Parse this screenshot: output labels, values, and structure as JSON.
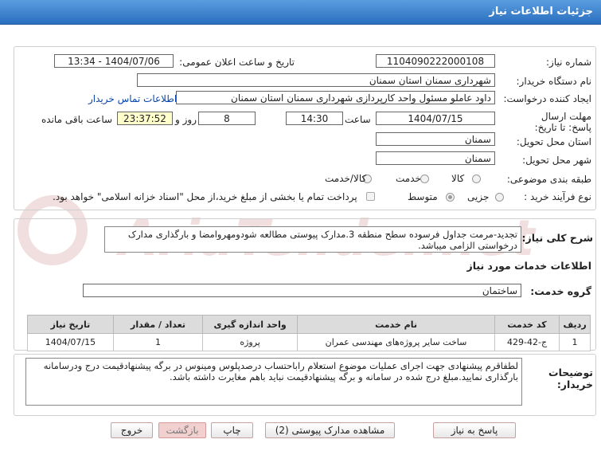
{
  "header": {
    "title": "جزئیات اطلاعات نیاز"
  },
  "form": {
    "need_number_label": "شماره نیاز:",
    "need_number": "1104090222000108",
    "announce_datetime_label": "تاریخ و ساعت اعلان عمومی:",
    "announce_datetime": "1404/07/06 - 13:34",
    "buyer_org_label": "نام دستگاه خریدار:",
    "buyer_org": "شهرداری سمنان استان سمنان",
    "requester_label": "ایجاد کننده درخواست:",
    "requester": "داود عاملو مسئول واحد کارپردازی شهرداری سمنان استان سمنان",
    "contact_link": "اطلاعات تماس خریدار",
    "deadline_label": "مهلت ارسال پاسخ: تا تاریخ:",
    "deadline_date": "1404/07/15",
    "time_label": "ساعت",
    "deadline_time": "14:30",
    "days_value": "8",
    "days_label": "روز و",
    "remaining_time": "23:37:52",
    "remaining_label": "ساعت باقی مانده",
    "province_label": "استان محل تحویل:",
    "province": "سمنان",
    "city_label": "شهر محل تحویل:",
    "city": "سمنان",
    "category_label": "طبقه بندی موضوعی:",
    "category_options": [
      "کالا",
      "خدمت",
      "کالا/خدمت"
    ],
    "process_label": "نوع فرآیند خرید :",
    "process_options": [
      "جزیی",
      "متوسط"
    ],
    "payment_note": "پرداخت تمام یا بخشی از مبلغ خرید،از محل \"اسناد خزانه اسلامی\" خواهد بود."
  },
  "summary": {
    "label": "شرح کلی نیاز:",
    "text": "تجدید-مرمت جداول فرسوده سطح منطقه 3.مدارک پیوستی مطالعه شودومهروامضا و بارگذاری مدارک درخواستی الزامی میباشد."
  },
  "services": {
    "section_title": "اطلاعات خدمات مورد نیاز",
    "group_label": "گروه خدمت:",
    "group_value": "ساختمان",
    "columns": [
      "ردیف",
      "کد خدمت",
      "نام خدمت",
      "واحد اندازه گیری",
      "تعداد / مقدار",
      "تاریخ نیاز"
    ],
    "rows": [
      [
        "1",
        "ج-42-429",
        "ساخت سایر پروژه‌های مهندسی عمران",
        "پروژه",
        "1",
        "1404/07/15"
      ]
    ]
  },
  "buyer_notes": {
    "label": "توضیحات خریدار:",
    "text": "لطفاقرم پیشنهادی جهت اجرای عملیات موضوع استعلام راباحتساب درصدپلوس ومینوس در برگه پیشنهادقیمت درج ودرسامانه بارگذاری نمایید.مبلغ درج شده در سامانه و برگه پیشنهادقیمت نباید باهم مغایرت داشته باشد."
  },
  "buttons": {
    "reply": "پاسخ به نیاز",
    "attachments": "مشاهده مدارک پیوستی (2)",
    "print": "چاپ",
    "back": "بازگشت",
    "exit": "خروج"
  },
  "watermark": "AriaTender.net",
  "colors": {
    "header": "#2a6fbf",
    "accent_link": "#0645ad",
    "highlight": "#ffffcc"
  }
}
